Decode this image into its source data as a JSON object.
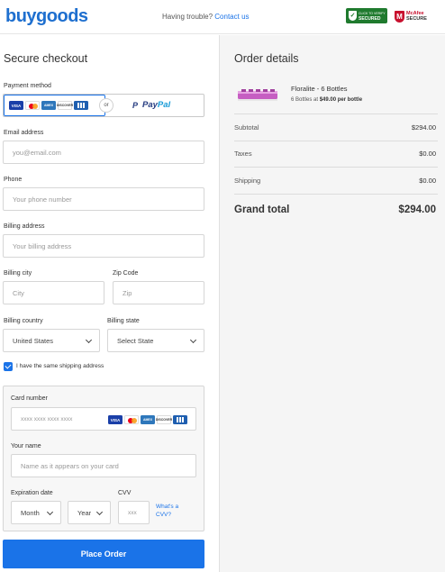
{
  "header": {
    "logo_text": "buygoods",
    "trouble_text": "Having trouble?",
    "contact_link": "Contact us",
    "secured_badge": "SECURED",
    "secured_badge_small": "CLICK TO VERIFY",
    "mcafee_badge_line1": "McAfee",
    "mcafee_badge_line2": "SECURE"
  },
  "checkout": {
    "title": "Secure checkout",
    "payment_method_label": "Payment method",
    "or_label": "or",
    "paypal_left": "Pay",
    "paypal_right": "Pal",
    "card_icons": [
      "visa-icon",
      "mastercard-icon",
      "amex-icon",
      "discover-icon",
      "jcb-icon"
    ],
    "card_texts": {
      "visa": "VISA",
      "amex": "AMEX",
      "discover": "DISCOVER"
    },
    "email": {
      "label": "Email address",
      "placeholder": "you@email.com"
    },
    "phone": {
      "label": "Phone",
      "placeholder": "Your phone number"
    },
    "billing_address": {
      "label": "Billing address",
      "placeholder": "Your billing address"
    },
    "billing_city": {
      "label": "Billing city",
      "placeholder": "City"
    },
    "zip": {
      "label": "Zip Code",
      "placeholder": "Zip"
    },
    "billing_country": {
      "label": "Billing country",
      "value": "United States"
    },
    "billing_state": {
      "label": "Billing state",
      "value": "Select State"
    },
    "same_shipping": {
      "label": "I have the same shipping address",
      "checked": true
    },
    "card_number": {
      "label": "Card number",
      "placeholder": "xxxx xxxx xxxx xxxx"
    },
    "your_name": {
      "label": "Your name",
      "placeholder": "Name as it appears on your card"
    },
    "expiration": {
      "label": "Expiration date",
      "month": "Month",
      "year": "Year"
    },
    "cvv": {
      "label": "CVV",
      "placeholder": "xxx",
      "help_line1": "What's a",
      "help_line2": "CVV?"
    },
    "place_order": "Place Order"
  },
  "order": {
    "title": "Order details",
    "product_name": "Floralite - 6 Bottles",
    "product_sub_prefix": "6 Bottles at ",
    "product_sub_price": "$49.00 per bottle",
    "subtotal_label": "Subtotal",
    "subtotal_value": "$294.00",
    "taxes_label": "Taxes",
    "taxes_value": "$0.00",
    "shipping_label": "Shipping",
    "shipping_value": "$0.00",
    "grand_total_label": "Grand total",
    "grand_total_value": "$294.00"
  },
  "colors": {
    "accent": "#1a73e8",
    "logo": "#1e6fcf",
    "secured_green": "#1f7a2e",
    "mcafee_red": "#c8102e"
  }
}
